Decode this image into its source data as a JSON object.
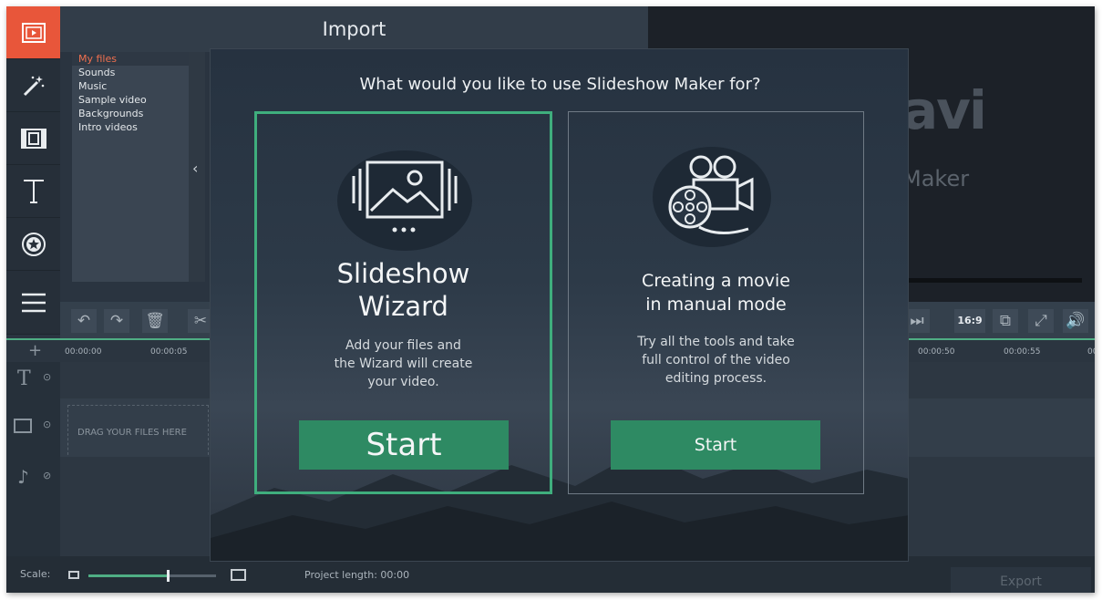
{
  "sidebar": {
    "tools": [
      {
        "icon": "import-icon"
      },
      {
        "icon": "magic-wand-icon"
      },
      {
        "icon": "transitions-icon"
      },
      {
        "icon": "titles-icon"
      },
      {
        "icon": "stickers-icon"
      },
      {
        "icon": "more-tools-icon"
      }
    ]
  },
  "import_panel": {
    "title": "Import",
    "categories": [
      "My files",
      "Sounds",
      "Music",
      "Sample video",
      "Backgrounds",
      "Intro videos"
    ],
    "selected": "My files"
  },
  "preview": {
    "logo_text": "avi",
    "logo_subtext": "Maker"
  },
  "timeline": {
    "aspect_ratio": "16:9",
    "ticks_left": [
      "00:00:00",
      "00:00:05"
    ],
    "ticks_right": [
      "00:00:50",
      "00:00:55",
      "00"
    ],
    "drag_hint": "DRAG YOUR FILES HERE"
  },
  "bottom_bar": {
    "scale_label": "Scale:",
    "scale_value": 0.62,
    "project_length_label": "Project length: 00:00",
    "export_label": "Export"
  },
  "modal": {
    "question": "What would you like to use Slideshow Maker for?",
    "wizard": {
      "title_line1": "Slideshow",
      "title_line2": "Wizard",
      "desc_line1": "Add your files and",
      "desc_line2": "the Wizard will create",
      "desc_line3": "your video.",
      "start_label": "Start"
    },
    "manual": {
      "title_line1": "Creating a movie",
      "title_line2": "in manual mode",
      "desc_line1": "Try all the tools and take",
      "desc_line2": "full control of the video",
      "desc_line3": "editing process.",
      "start_label": "Start"
    }
  },
  "colors": {
    "accent_green": "#3fae7d",
    "button_green": "#2e8a63",
    "active_tool": "#e8563a"
  }
}
